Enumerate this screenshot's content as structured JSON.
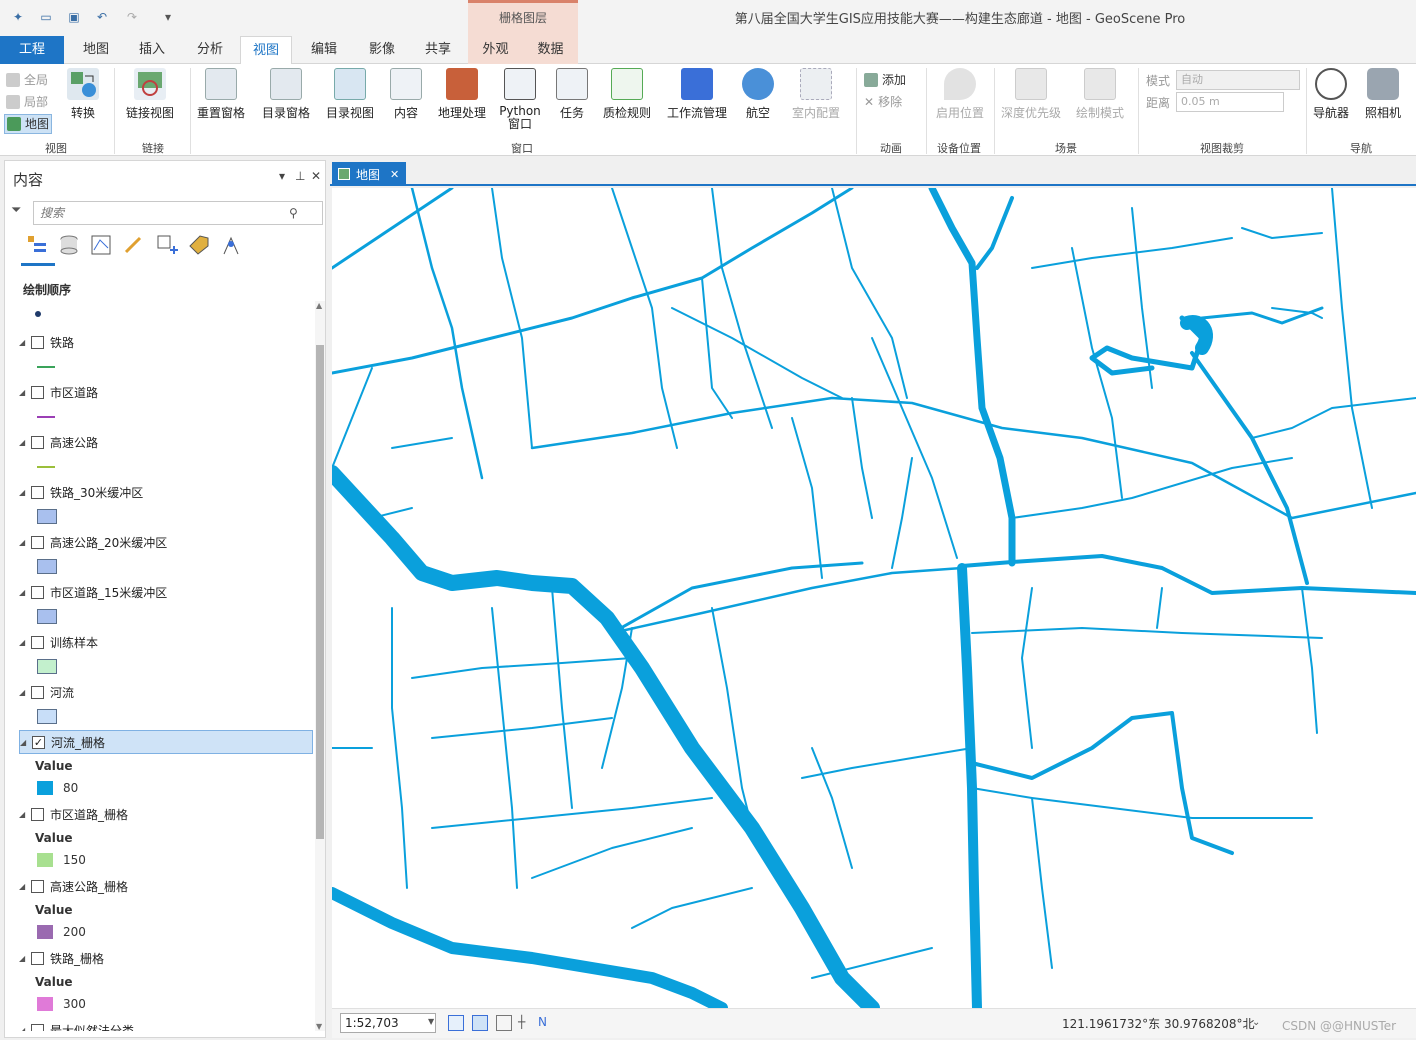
{
  "title_bar": {
    "window_title": "第八届全国大学生GIS应用技能大赛——构建生态廊道 - 地图 - GeoScene Pro",
    "context_group": "栅格图层"
  },
  "tabs": {
    "project": "工程",
    "map": "地图",
    "insert": "插入",
    "analysis": "分析",
    "view": "视图",
    "edit": "编辑",
    "imagery": "影像",
    "share": "共享",
    "appearance": "外观",
    "data": "数据"
  },
  "ribbon": {
    "view_group": {
      "full": "全局",
      "local": "局部",
      "map": "地图",
      "convert": "转换",
      "label": "视图"
    },
    "link_group": {
      "link_views": "链接视图",
      "label": "链接"
    },
    "window_group": {
      "reset_panes": "重置窗格",
      "catalog_pane": "目录窗格",
      "catalog_view": "目录视图",
      "contents": "内容",
      "geoprocessing": "地理处理",
      "python_line1": "Python",
      "python_line2": "窗口",
      "tasks": "任务",
      "quality_rules": "质检规则",
      "workflow_mgmt": "工作流管理",
      "aviation": "航空",
      "indoor_config": "室内配置",
      "label": "窗口"
    },
    "animation_group": {
      "add": "添加",
      "remove": "移除",
      "label": "动画"
    },
    "device_group": {
      "enable_location": "启用位置",
      "label": "设备位置"
    },
    "scene_group": {
      "depth_priority": "深度优先级",
      "draw_mode": "绘制模式",
      "label": "场景"
    },
    "clip_group": {
      "mode_label": "模式",
      "mode_value": "自动",
      "distance_label": "距离",
      "distance_value": "0.05 m",
      "label": "视图裁剪"
    },
    "nav_group": {
      "navigator": "导航器",
      "camera": "照相机",
      "label": "导航"
    }
  },
  "contents": {
    "title": "内容",
    "search_placeholder": "搜索",
    "draw_order": "绘制顺序",
    "layers": [
      {
        "name": "铁路",
        "checked": false,
        "symbol": "line",
        "color": "#3aa35a"
      },
      {
        "name": "市区道路",
        "checked": false,
        "symbol": "line",
        "color": "#9b3fb5"
      },
      {
        "name": "高速公路",
        "checked": false,
        "symbol": "line",
        "color": "#9bbf3a"
      },
      {
        "name": "铁路_30米缓冲区",
        "checked": false,
        "symbol": "patch",
        "color": "#a9c0ee"
      },
      {
        "name": "高速公路_20米缓冲区",
        "checked": false,
        "symbol": "patch",
        "color": "#a9c0ee"
      },
      {
        "name": "市区道路_15米缓冲区",
        "checked": false,
        "symbol": "patch",
        "color": "#a9c0ee"
      },
      {
        "name": "训练样本",
        "checked": false,
        "symbol": "patch",
        "color": "#c3f0cd"
      },
      {
        "name": "河流",
        "checked": false,
        "symbol": "patch",
        "color": "#c8def8"
      },
      {
        "name": "河流_栅格",
        "checked": true,
        "symbol": "raster",
        "value_label": "Value",
        "value": "80",
        "color": "#0aa0dc"
      },
      {
        "name": "市区道路_栅格",
        "checked": false,
        "symbol": "raster",
        "value_label": "Value",
        "value": "150",
        "color": "#a8e090"
      },
      {
        "name": "高速公路_栅格",
        "checked": false,
        "symbol": "raster",
        "value_label": "Value",
        "value": "200",
        "color": "#9a6ab0"
      },
      {
        "name": "铁路_栅格",
        "checked": false,
        "symbol": "raster",
        "value_label": "Value",
        "value": "300",
        "color": "#e07ad8"
      },
      {
        "name": "最大似然法分类",
        "checked": false,
        "symbol": "none",
        "color": "#ffffff"
      }
    ]
  },
  "map": {
    "tab_label": "地图",
    "scale": "1:52,703",
    "coordinates": "121.1961732°东 30.9768208°北",
    "watermark": "CSDN @@HNUSTer",
    "river_color": "#0aa0dc"
  }
}
